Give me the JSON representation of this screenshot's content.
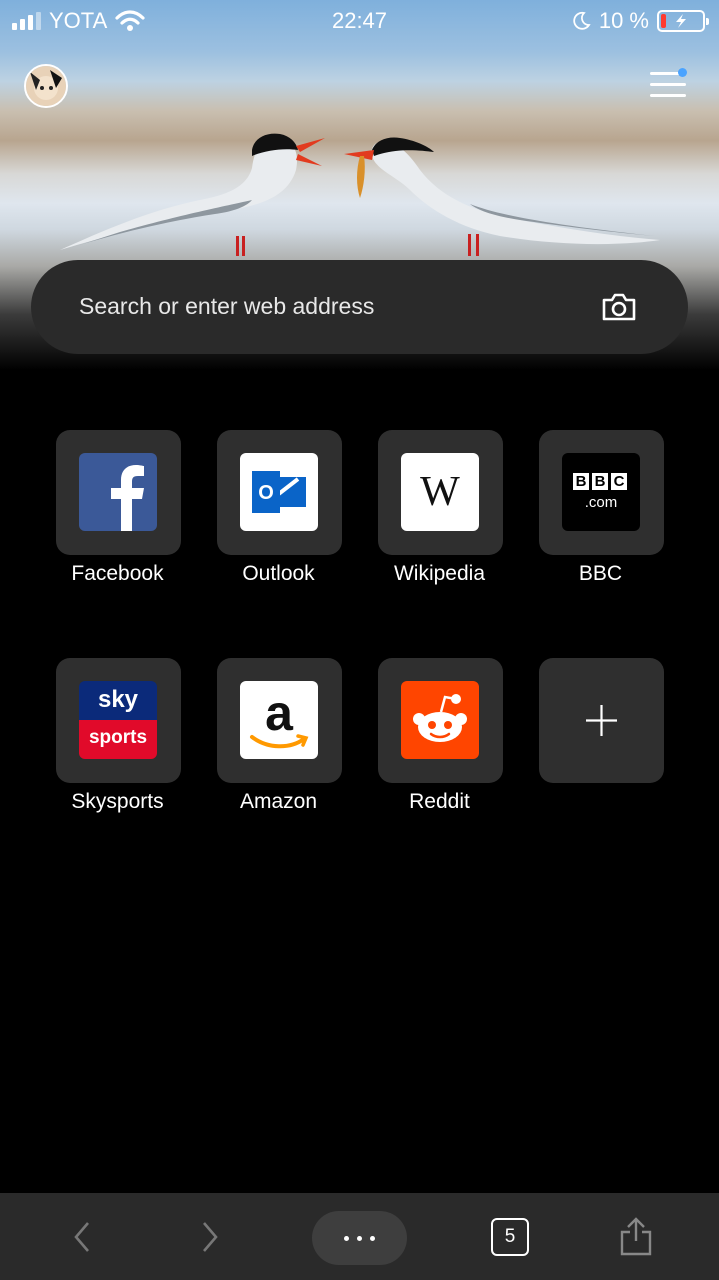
{
  "status_bar": {
    "carrier": "YOTA",
    "time": "22:47",
    "battery": "10 %"
  },
  "search": {
    "placeholder": "Search or enter web address"
  },
  "speed_dial": [
    {
      "label": "Facebook",
      "icon": "facebook-icon"
    },
    {
      "label": "Outlook",
      "icon": "outlook-icon"
    },
    {
      "label": "Wikipedia",
      "icon": "wikipedia-icon"
    },
    {
      "label": "BBC",
      "icon": "bbc-icon"
    },
    {
      "label": "Skysports",
      "icon": "skysports-icon"
    },
    {
      "label": "Amazon",
      "icon": "amazon-icon"
    },
    {
      "label": "Reddit",
      "icon": "reddit-icon"
    }
  ],
  "icon_text": {
    "wiki": "W",
    "bbc_a": "B",
    "bbc_b": "B",
    "bbc_c": "C",
    "bbc_com": ".com",
    "sky": "sky",
    "sports": "sports",
    "amazon": "a",
    "outlook": "O"
  },
  "toolbar": {
    "tab_count": "5"
  },
  "colors": {
    "facebook": "#3b5998",
    "outlook": "#0a64c8",
    "reddit": "#ff4500",
    "skysports_top": "#0b2a7a",
    "skysports_bottom": "#e10a2a"
  }
}
